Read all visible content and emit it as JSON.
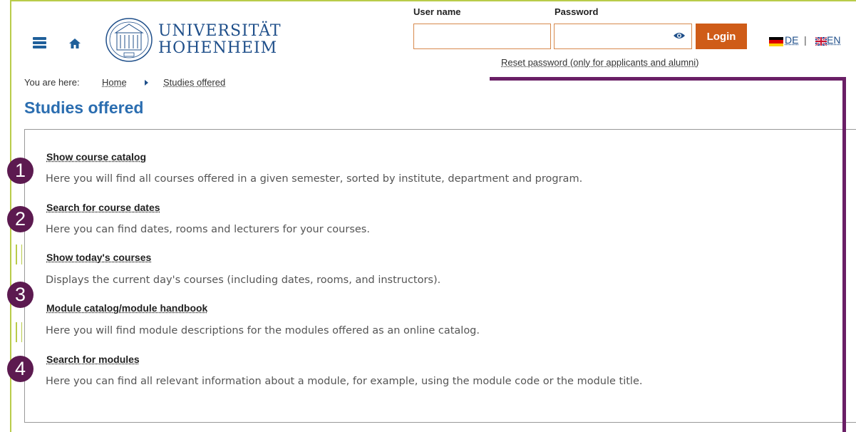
{
  "header": {
    "logo_line1": "UNIVERSITÄT",
    "logo_line2": "HOHENHEIM",
    "username_label": "User name",
    "password_label": "Password",
    "login_label": "Login",
    "reset_link": "Reset password (only for applicants and alumni)",
    "lang_de": "DE",
    "lang_sep": "|",
    "lang_en": "EN"
  },
  "breadcrumb": {
    "prefix": "You are here:",
    "home": "Home",
    "current": "Studies offered"
  },
  "page_title": "Studies offered",
  "items": [
    {
      "title": "Show course catalog",
      "desc": "Here you will find all courses offered in a given semester, sorted by institute, department and program."
    },
    {
      "title": "Search for course dates",
      "desc": "Here you can find dates, rooms and lecturers for your courses."
    },
    {
      "title": "Show today's courses",
      "desc": "Displays the current day's courses (including dates, rooms, and instructors)."
    },
    {
      "title": "Module catalog/module handbook",
      "desc": "Here you will find module descriptions for the modules offered as an online catalog."
    },
    {
      "title": "Search for modules",
      "desc": "Here you can find all relevant information about a module, for example, using the module code or the module title."
    }
  ],
  "annotations": [
    "1",
    "2",
    "3",
    "4"
  ],
  "colors": {
    "accent_green": "#b9cc4a",
    "brand_blue": "#1f4f8a",
    "login_orange": "#cf5c18",
    "annotation_purple": "#5c1a50"
  },
  "icons": [
    "menu-icon",
    "home-icon",
    "university-logo",
    "eye-icon",
    "flag-de-icon",
    "flag-uk-icon"
  ]
}
